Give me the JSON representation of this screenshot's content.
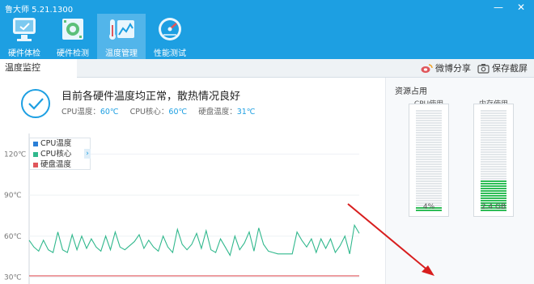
{
  "window": {
    "title": "鲁大师 5.21.1300",
    "min": "—",
    "close": "✕"
  },
  "nav": [
    {
      "label": "硬件体检",
      "icon": "monitor-check-icon"
    },
    {
      "label": "硬件检测",
      "icon": "circuit-board-icon"
    },
    {
      "label": "温度管理",
      "icon": "temperature-chart-icon",
      "active": true
    },
    {
      "label": "性能测试",
      "icon": "speedometer-icon"
    }
  ],
  "tabs": {
    "temp_monitor": "温度监控"
  },
  "actions": {
    "share": "微博分享",
    "save_screenshot": "保存截屏"
  },
  "status": {
    "title": "目前各硬件温度均正常，散热情况良好",
    "cpu_temp_label": "CPU温度：",
    "cpu_temp_value": "60℃",
    "cpu_core_label": "CPU核心：",
    "cpu_core_value": "60℃",
    "disk_temp_label": "硬盘温度：",
    "disk_temp_value": "31℃"
  },
  "chart_data": {
    "type": "line",
    "y_ticks": [
      "120℃",
      "90℃",
      "60℃",
      "30℃"
    ],
    "ylim": [
      25,
      135
    ],
    "grid": true,
    "legend_position": "top-left",
    "series": [
      {
        "name": "CPU温度",
        "color": "#2b7fd6",
        "values": []
      },
      {
        "name": "CPU核心",
        "color": "#31b88d",
        "values": [
          57,
          52,
          49,
          57,
          50,
          48,
          63,
          50,
          48,
          61,
          50,
          60,
          51,
          58,
          52,
          49,
          60,
          50,
          63,
          52,
          50,
          53,
          56,
          61,
          51,
          57,
          52,
          49,
          60,
          52,
          48,
          65,
          54,
          50,
          54,
          62,
          51,
          64,
          50,
          48,
          58,
          52,
          46,
          60,
          50,
          55,
          63,
          49,
          66,
          54,
          49,
          48,
          47,
          47,
          47,
          47,
          63,
          57,
          52,
          58,
          48,
          58,
          51,
          58,
          48,
          53,
          60,
          47,
          68,
          62
        ]
      },
      {
        "name": "硬盘温度",
        "color": "#e0565b",
        "values": [
          31,
          31,
          31,
          31,
          31,
          31,
          31,
          31,
          31,
          31,
          31,
          31,
          31,
          31,
          31,
          31,
          31,
          31,
          31,
          31,
          31,
          31,
          31,
          31,
          31,
          31,
          31,
          31,
          31,
          31,
          31,
          31,
          31,
          31,
          31,
          31,
          31,
          31,
          31,
          31,
          31,
          31,
          31,
          31,
          31,
          31,
          31,
          31,
          31,
          31,
          31,
          31,
          31,
          31,
          31,
          31,
          31,
          31,
          31,
          31,
          31,
          31,
          31,
          31,
          31,
          31,
          31,
          31,
          31,
          31
        ]
      }
    ]
  },
  "resources": {
    "title": "资源占用",
    "cpu": {
      "label": "CPU使用",
      "value": "4%",
      "fraction": 0.04
    },
    "mem": {
      "label": "内存使用",
      "value": "2.4 GB",
      "fraction": 0.3
    }
  },
  "colors": {
    "titlebar": "#1d9fe2",
    "accent": "#1d9fe2",
    "meter_fill": "#2fbd57"
  }
}
